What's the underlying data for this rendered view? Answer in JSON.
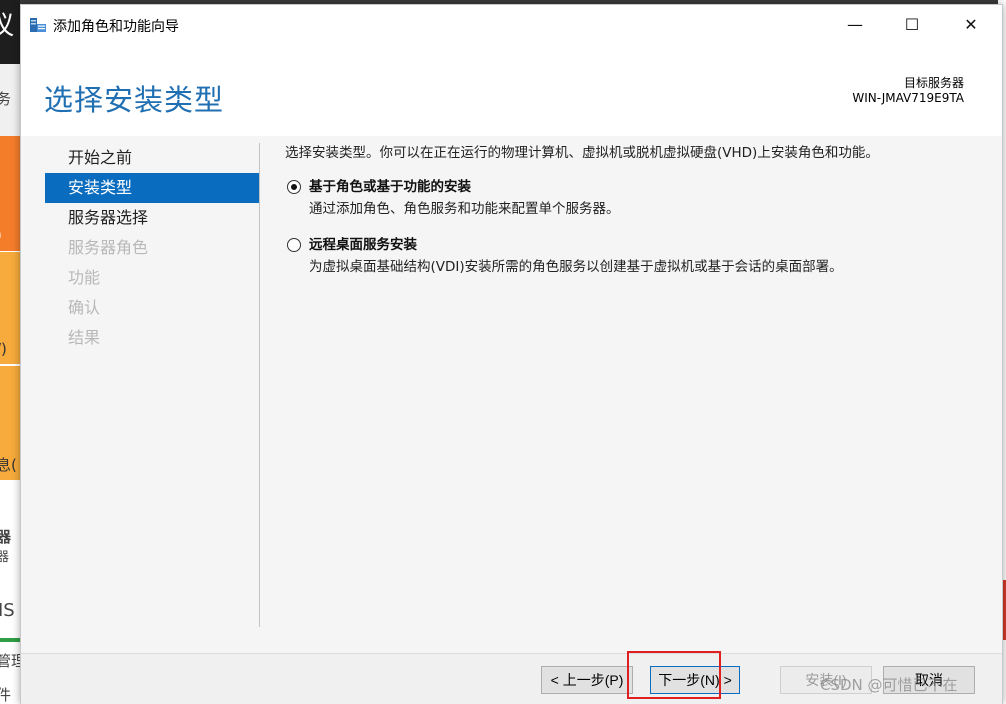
{
  "window": {
    "title": "添加角色和功能向导",
    "minimize_glyph": "—",
    "maximize_glyph": "☐",
    "close_glyph": "✕"
  },
  "header": {
    "page_title": "选择安装类型",
    "target_label": "目标服务器",
    "target_name": "WIN-JMAV719E9TA"
  },
  "nav": {
    "items": [
      {
        "label": "开始之前",
        "state": "normal"
      },
      {
        "label": "安装类型",
        "state": "active"
      },
      {
        "label": "服务器选择",
        "state": "normal"
      },
      {
        "label": "服务器角色",
        "state": "disabled"
      },
      {
        "label": "功能",
        "state": "disabled"
      },
      {
        "label": "确认",
        "state": "disabled"
      },
      {
        "label": "结果",
        "state": "disabled"
      }
    ]
  },
  "content": {
    "description": "选择安装类型。你可以在正在运行的物理计算机、虚拟机或脱机虚拟硬盘(VHD)上安装角色和功能。",
    "options": [
      {
        "title": "基于角色或基于功能的安装",
        "description": "通过添加角色、角色服务和功能来配置单个服务器。",
        "checked": true
      },
      {
        "title": "远程桌面服务安装",
        "description": "为虚拟桌面基础结构(VDI)安装所需的角色服务以创建基于虚拟机或基于会话的桌面部署。",
        "checked": false
      }
    ]
  },
  "footer": {
    "prev_label": "< 上一步(P)",
    "next_label": "下一步(N) >",
    "install_label": "安装(I)",
    "cancel_label": "取消"
  },
  "background": {
    "fragments": [
      "议",
      "务",
      ")",
      "/)",
      "息(",
      "器",
      "器",
      "IS",
      "管理",
      "件"
    ]
  },
  "watermark": "CSDN @可惜已不在",
  "colors": {
    "accent": "#0a6cbf",
    "title_blue": "#1f6fb2",
    "highlight_red": "#e02020"
  }
}
